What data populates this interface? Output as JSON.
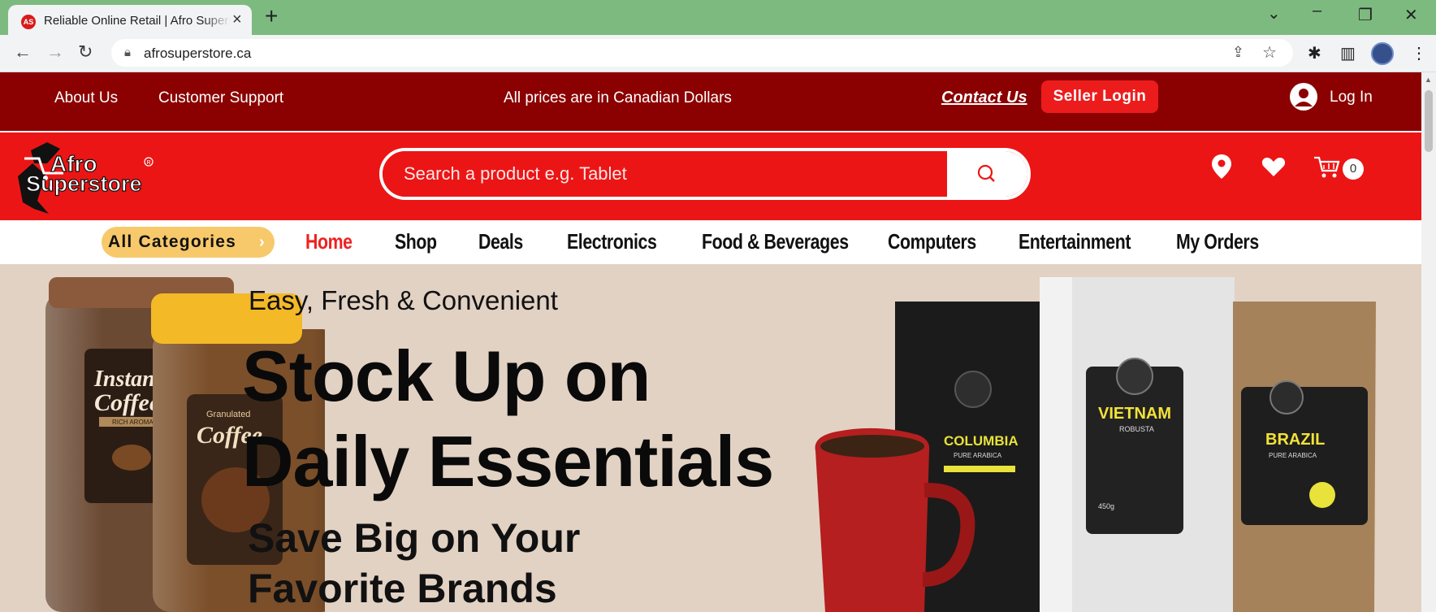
{
  "browser": {
    "tab_title": "Reliable Online Retail | Afro Superstore",
    "tab_favicon_text": "AS",
    "url": "afrosuperstore.ca"
  },
  "topbar": {
    "about_us": "About Us",
    "customer_support": "Customer Support",
    "currency_note": "All prices are in Canadian Dollars",
    "contact_us": "Contact Us",
    "seller_login": "Seller Login",
    "login": "Log In"
  },
  "header": {
    "logo_text": "Afro Superstore",
    "search_placeholder": "Search a product e.g. Tablet",
    "cart_count": "0"
  },
  "nav": {
    "all_categories": "All Categories",
    "items": [
      "Home",
      "Shop",
      "Deals",
      "Electronics",
      "Food & Beverages",
      "Computers",
      "Entertainment",
      "My Orders"
    ],
    "active": "Home"
  },
  "hero": {
    "kicker": "Easy, Fresh & Convenient",
    "title_line1": "Stock Up on",
    "title_line2": "Daily Essentials",
    "sub_line1": "Save Big on Your",
    "sub_line2": "Favorite Brands",
    "jar1_label_1": "Instant",
    "jar1_label_2": "Coffee",
    "jar1_tag": "RICH AROMA",
    "jar2_label": "Coffee",
    "jar2_small": "Granulated",
    "bag1_label": "COLUMBIA",
    "bag1_sub": "PURE ARABICA",
    "bag2_label": "VIETNAM",
    "bag2_sub": "ROBUSTA",
    "bag2_weight": "450g",
    "bag3_label": "BRAZIL",
    "bag3_sub": "PURE ARABICA"
  },
  "colors": {
    "topbar": "#8b0101",
    "header": "#ec1515",
    "accent": "#f7c96b",
    "hero_bg": "#e2d2c4"
  }
}
